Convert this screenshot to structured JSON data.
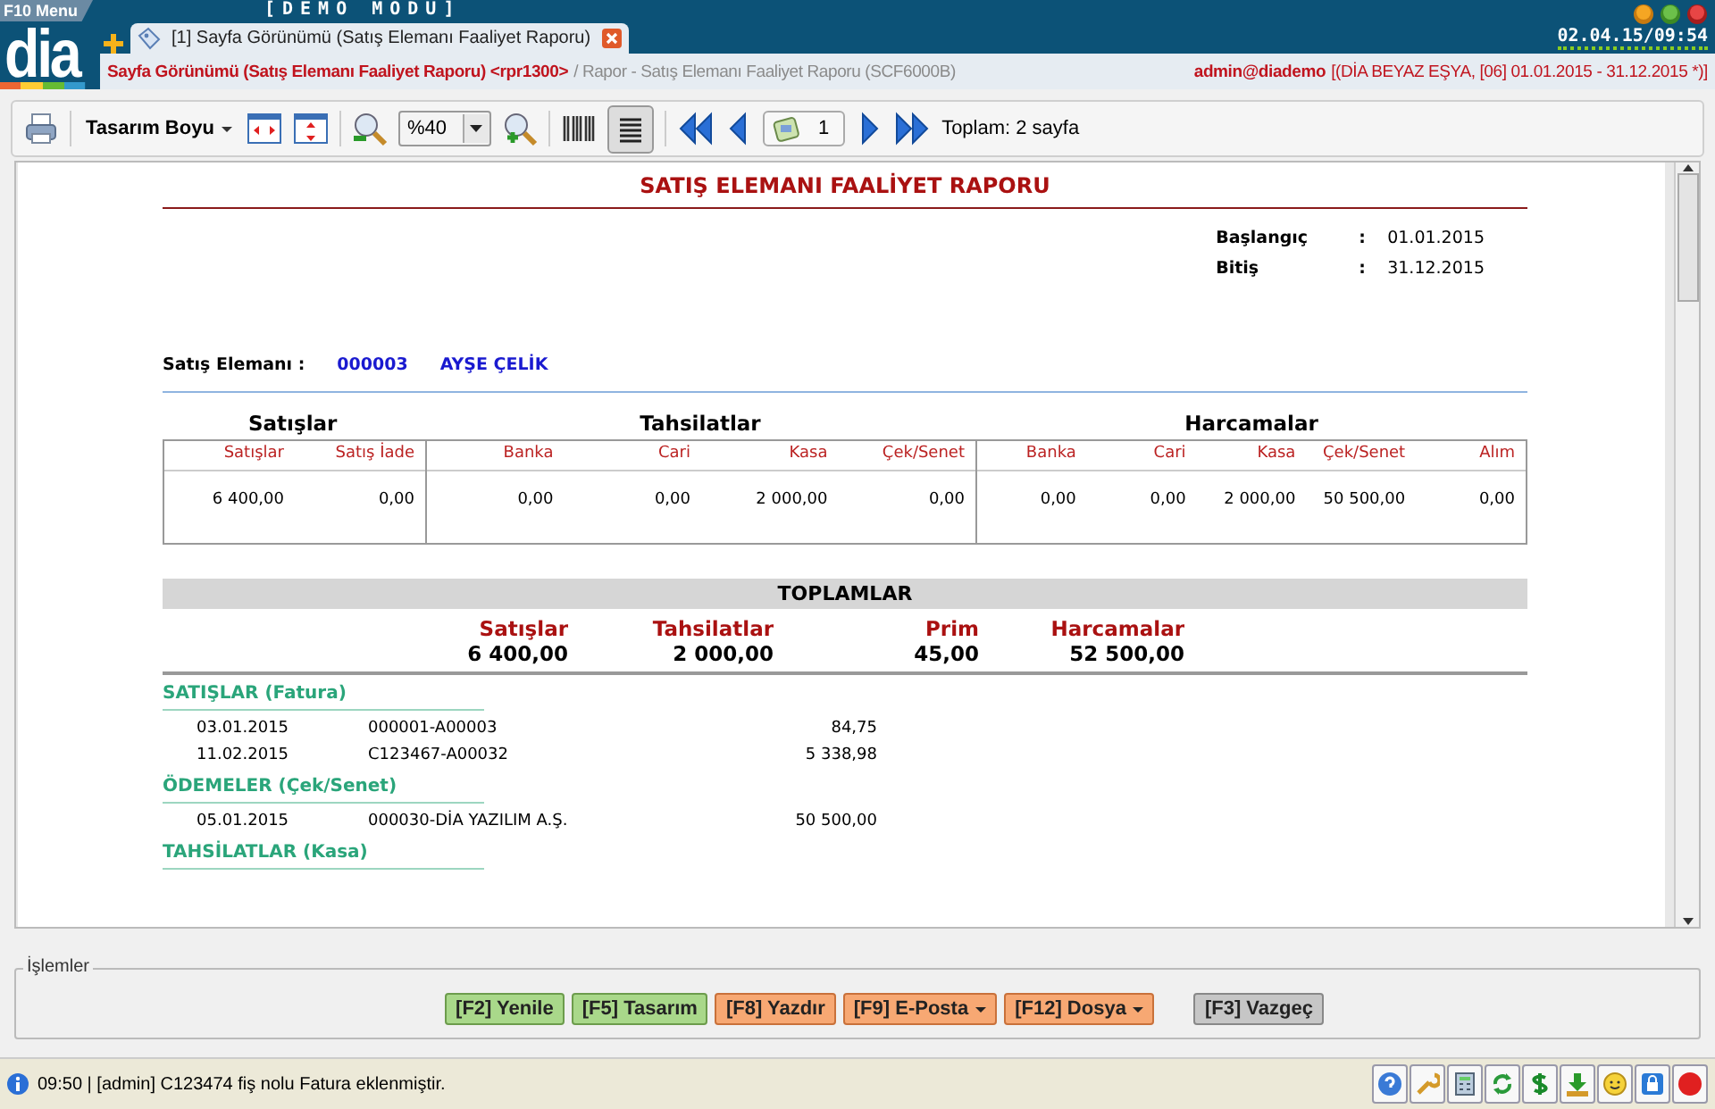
{
  "app": {
    "menu_label": "F10 Menu",
    "mode": "[DEMO MODU]",
    "logo": "dia",
    "datetime": "02.04.15/09:54"
  },
  "tabs": [
    {
      "label": "[1] Sayfa Görünümü (Satış Elemanı Faaliyet Raporu)",
      "selected": true
    }
  ],
  "breadcrumb": {
    "title": "Sayfa Görünümü (Satış Elemanı Faaliyet Raporu) <rpr1300>",
    "path": "/ Rapor - Satış Elemanı Faaliyet Raporu (SCF6000B)",
    "user": "admin@diademo",
    "context": "[(DİA BEYAZ EŞYA, [06] 01.01.2015 - 31.12.2015 *)]"
  },
  "toolbar": {
    "design_menu": "Tasarım Boyu",
    "zoom": "%40",
    "page": "1",
    "total": "Toplam: 2 sayfa"
  },
  "report": {
    "title": "SATIŞ ELEMANI FAALİYET RAPORU",
    "params": [
      {
        "label": "Başlangıç",
        "separator": ":",
        "value": "01.01.2015"
      },
      {
        "label": "Bitiş",
        "separator": ":",
        "value": "31.12.2015"
      }
    ],
    "salesperson": {
      "label": "Satış Elemanı :",
      "code": "000003",
      "name": "AYŞE ÇELİK"
    },
    "groups": [
      {
        "title": "Satışlar",
        "columns": [
          "Satışlar",
          "Satış İade"
        ],
        "values": [
          "6 400,00",
          "0,00"
        ]
      },
      {
        "title": "Tahsilatlar",
        "columns": [
          "Banka",
          "Cari",
          "Kasa",
          "Çek/Senet"
        ],
        "values": [
          "0,00",
          "0,00",
          "2 000,00",
          "0,00"
        ]
      },
      {
        "title": "Harcamalar",
        "columns": [
          "Banka",
          "Cari",
          "Kasa",
          "Çek/Senet",
          "Alım"
        ],
        "values": [
          "0,00",
          "0,00",
          "2 000,00",
          "50 500,00",
          "0,00"
        ]
      }
    ],
    "totals": {
      "title": "TOPLAMLAR",
      "items": [
        {
          "label": "Satışlar",
          "value": "6 400,00"
        },
        {
          "label": "Tahsilatlar",
          "value": "2 000,00"
        },
        {
          "label": "Prim",
          "value": "45,00"
        },
        {
          "label": "Harcamalar",
          "value": "52 500,00"
        }
      ]
    },
    "sections": [
      {
        "title": "SATIŞLAR (Fatura)",
        "rows": [
          {
            "date": "03.01.2015",
            "document": "000001-A00003",
            "amount": "84,75"
          },
          {
            "date": "11.02.2015",
            "document": "C123467-A00032",
            "amount": "5 338,98"
          }
        ]
      },
      {
        "title": "ÖDEMELER (Çek/Senet)",
        "rows": [
          {
            "date": "05.01.2015",
            "document": "000030-DİA YAZILIM A.Ş.",
            "amount": "50 500,00"
          }
        ]
      },
      {
        "title": "TAHSİLATLAR (Kasa)"
      }
    ]
  },
  "actions": {
    "legend": "İşlemler",
    "buttons": [
      {
        "label": "[F2] Yenile",
        "kind": "green",
        "dropdown": false
      },
      {
        "label": "[F5] Tasarım",
        "kind": "green",
        "dropdown": false
      },
      {
        "label": "[F8] Yazdır",
        "kind": "orange",
        "dropdown": false
      },
      {
        "label": "[F9] E-Posta",
        "kind": "orange",
        "dropdown": true
      },
      {
        "label": "[F12] Dosya",
        "kind": "orange",
        "dropdown": true
      },
      {
        "label": "[F3] Vazgeç",
        "kind": "gray",
        "dropdown": false
      }
    ]
  },
  "status": {
    "message": "09:50 | [admin] C123474 fiş nolu Fatura eklenmiştir."
  }
}
